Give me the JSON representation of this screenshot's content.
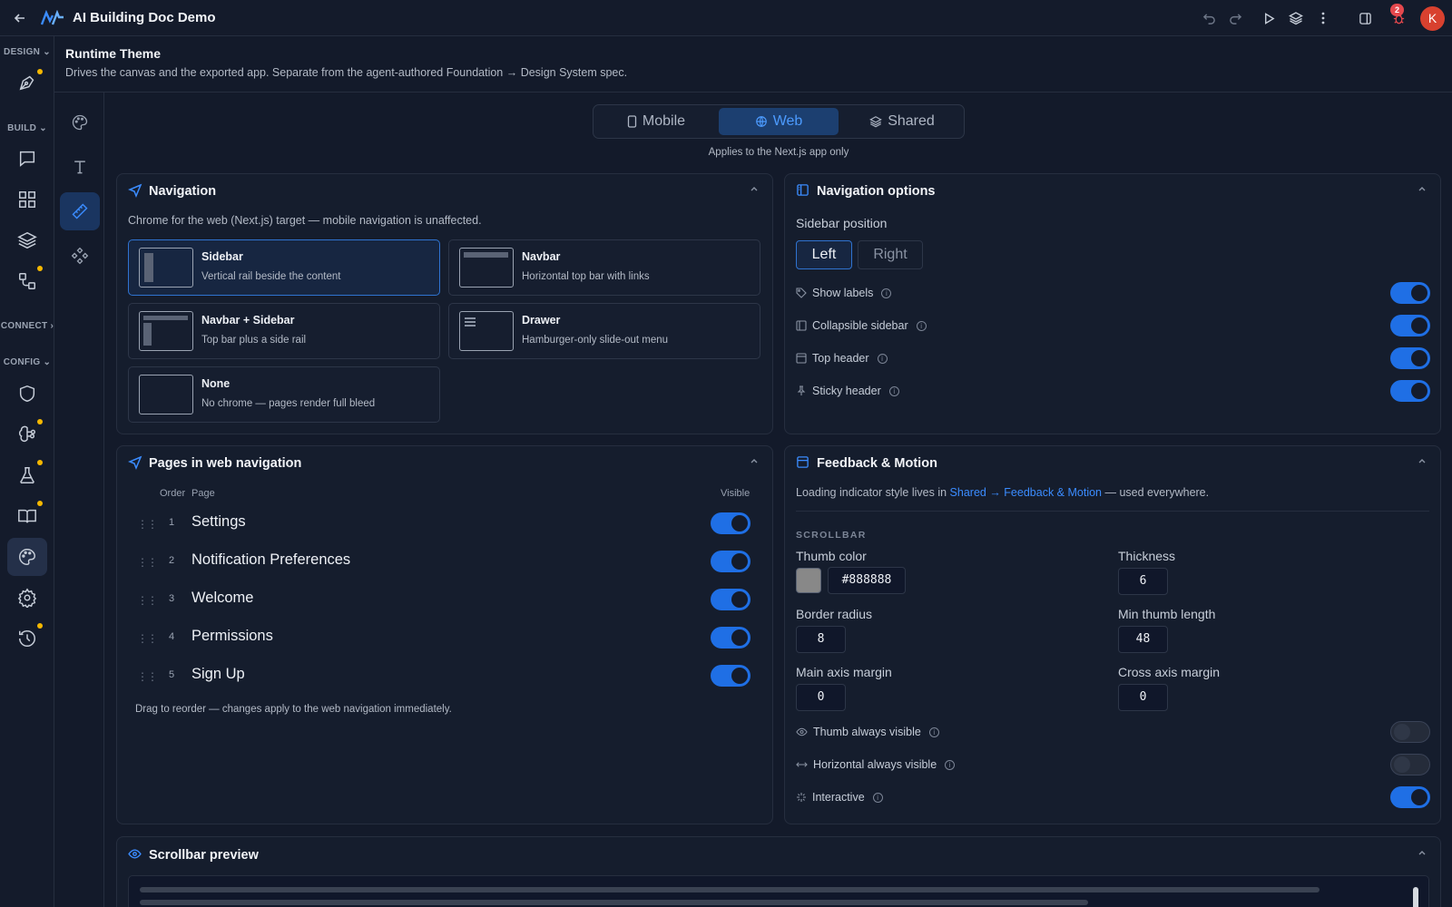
{
  "app": {
    "title": "AI Building Doc Demo",
    "avatar_letter": "K",
    "bug_count": "2"
  },
  "rail": {
    "sections": {
      "design": "DESIGN",
      "build": "BUILD",
      "connect": "CONNECT",
      "config": "CONFIG"
    }
  },
  "header": {
    "title": "Runtime Theme",
    "subtitle": "Drives the canvas and the exported app. Separate from the agent-authored Foundation → Design System spec."
  },
  "platform_tabs": {
    "mobile": "Mobile",
    "web": "Web",
    "shared": "Shared",
    "selected": "Web",
    "note": "Applies to the Next.js app only"
  },
  "navigation": {
    "title": "Navigation",
    "description": "Chrome for the web (Next.js) target — mobile navigation is unaffected.",
    "selected": "Sidebar",
    "options": [
      {
        "title": "Sidebar",
        "desc": "Vertical rail beside the content"
      },
      {
        "title": "Navbar",
        "desc": "Horizontal top bar with links"
      },
      {
        "title": "Navbar + Sidebar",
        "desc": "Top bar plus a side rail"
      },
      {
        "title": "Drawer",
        "desc": "Hamburger-only slide-out menu"
      },
      {
        "title": "None",
        "desc": "No chrome — pages render full bleed"
      }
    ]
  },
  "navigation_options": {
    "title": "Navigation options",
    "sidebar_position_label": "Sidebar position",
    "left": "Left",
    "right": "Right",
    "selected_position": "Left",
    "toggles": [
      {
        "label": "Show labels",
        "on": true
      },
      {
        "label": "Collapsible sidebar",
        "on": true
      },
      {
        "label": "Top header",
        "on": true
      },
      {
        "label": "Sticky header",
        "on": true
      }
    ]
  },
  "pages": {
    "title": "Pages in web navigation",
    "col_order": "Order",
    "col_page": "Page",
    "col_visible": "Visible",
    "rows": [
      {
        "order": "1",
        "name": "Settings",
        "visible": true
      },
      {
        "order": "2",
        "name": "Notification Preferences",
        "visible": true
      },
      {
        "order": "3",
        "name": "Welcome",
        "visible": true
      },
      {
        "order": "4",
        "name": "Permissions",
        "visible": true
      },
      {
        "order": "5",
        "name": "Sign Up",
        "visible": true
      }
    ],
    "footer": "Drag to reorder — changes apply to the web navigation immediately."
  },
  "feedback": {
    "title": "Feedback & Motion",
    "note_prefix": "Loading indicator style lives in ",
    "note_link": "Shared → Feedback & Motion",
    "note_suffix": " — used everywhere.",
    "section": "SCROLLBAR",
    "thumb_color_label": "Thumb color",
    "thumb_color": "#888888",
    "thickness_label": "Thickness",
    "thickness": "6",
    "border_radius_label": "Border radius",
    "border_radius": "8",
    "min_thumb_label": "Min thumb length",
    "min_thumb": "48",
    "main_margin_label": "Main axis margin",
    "main_margin": "0",
    "cross_margin_label": "Cross axis margin",
    "cross_margin": "0",
    "toggles": [
      {
        "label": "Thumb always visible",
        "on": false
      },
      {
        "label": "Horizontal always visible",
        "on": false
      },
      {
        "label": "Interactive",
        "on": true
      }
    ]
  },
  "preview": {
    "title": "Scrollbar preview"
  },
  "colors": {
    "accent": "#1f6fe5",
    "background": "#131a2a",
    "dot": "#f5b800"
  }
}
